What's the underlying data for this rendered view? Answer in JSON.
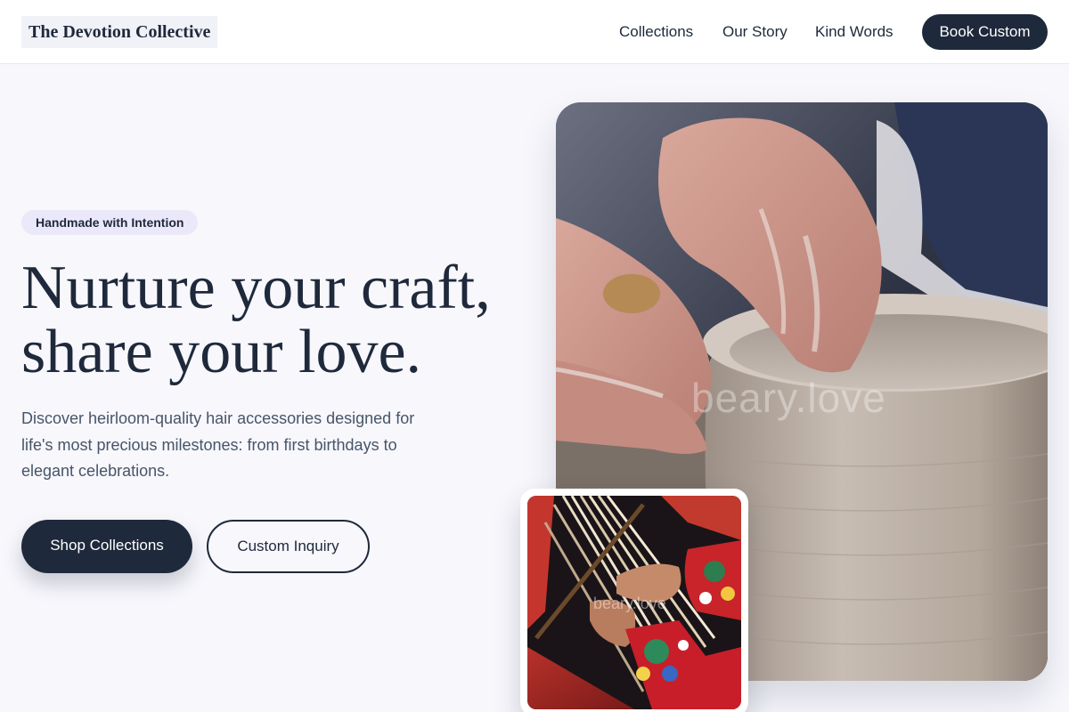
{
  "header": {
    "logo": "The Devotion Collective",
    "nav": [
      "Collections",
      "Our Story",
      "Kind Words"
    ],
    "cta": "Book Custom"
  },
  "hero": {
    "badge": "Handmade with Intention",
    "headline_line1": "Nurture your craft,",
    "headline_line2": "share your love.",
    "description": "Discover heirloom-quality hair accessories designed for life's most precious milestones: from first birthdays to elegant celebrations.",
    "primary_button": "Shop Collections",
    "secondary_button": "Custom Inquiry"
  },
  "images": {
    "main_watermark": "beary.love",
    "inset_watermark": "beary.love"
  },
  "colors": {
    "primary": "#1e293b",
    "background": "#f7f7fc",
    "badge_bg": "#ebe8fa",
    "text_muted": "#475569"
  }
}
